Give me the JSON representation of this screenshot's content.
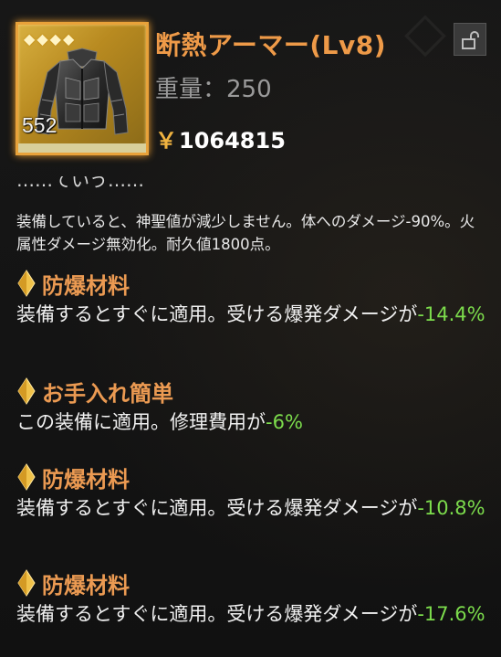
{
  "item": {
    "name": "断熱アーマー(Lv8)",
    "weight_label": "重量：",
    "weight_value": "250",
    "currency_symbol": "￥",
    "price": "1064815",
    "quantity": "552",
    "rarity_stars": 4,
    "durability_fraction": 1.0,
    "icon": "armor-jacket-icon"
  },
  "lock": {
    "icon": "unlocked-padlock-icon"
  },
  "cutoff_line": "……ていう……",
  "description": "装備していると、神聖値が減少しません。体へのダメージ-90%。火属性ダメージ無効化。耐久値1800点。",
  "perks": [
    {
      "name": "防爆材料",
      "text": "装備するとすぐに適用。受ける爆発ダメージが",
      "value": "-14.4%",
      "suffix": ""
    },
    {
      "name": "お手入れ簡単",
      "text": "この装備に適用。修理費用が",
      "value": "-6%",
      "suffix": ""
    },
    {
      "name": "防爆材料",
      "text": "装備するとすぐに適用。受ける爆発ダメージが",
      "value": "-10.8%",
      "suffix": ""
    },
    {
      "name": "防爆材料",
      "text": "装備するとすぐに適用。受ける爆発ダメージが",
      "value": "-17.6%",
      "suffix": ""
    }
  ],
  "colors": {
    "title": "#ee9a48",
    "perk_name": "#eb9a52",
    "positive_value": "#7cdc4c",
    "frame": "#e8a23a"
  }
}
